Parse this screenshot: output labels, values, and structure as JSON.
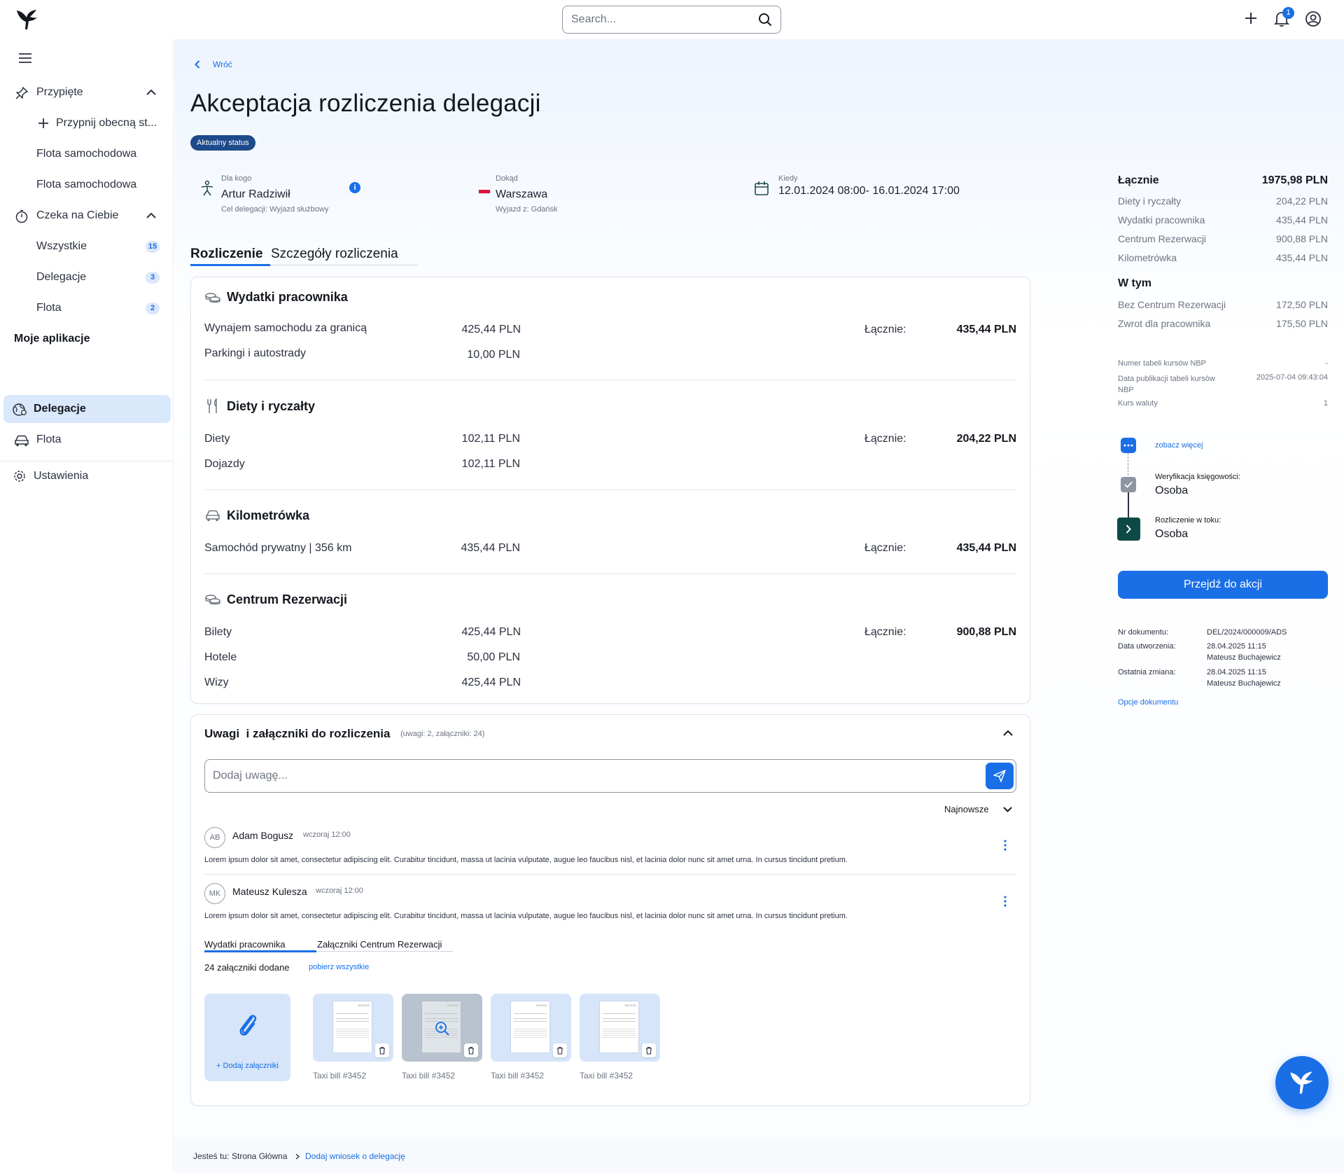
{
  "header": {
    "search_placeholder": "Search...",
    "notification_count": "1"
  },
  "sidebar": {
    "pinned_label": "Przypięte",
    "pin_current_label": "Przypnij obecną st...",
    "pinned_items": [
      "Flota samochodowa",
      "Flota samochodowa"
    ],
    "waiting_label": "Czeka na Ciebie",
    "waiting_items": [
      {
        "label": "Wszystkie",
        "badge": "15"
      },
      {
        "label": "Delegacje",
        "badge": "3"
      },
      {
        "label": "Flota",
        "badge": "2"
      }
    ],
    "apps_heading": "Moje aplikacje",
    "apps": [
      {
        "label": "Delegacje"
      },
      {
        "label": "Flota"
      }
    ],
    "settings_label": "Ustawienia"
  },
  "page": {
    "back_label": "Wróć",
    "title": "Akceptacja rozliczenia delegacji",
    "status_badge": "Aktualny status",
    "for_whom_label": "Dla kogo",
    "for_whom_value": "Artur Radziwił",
    "purpose": "Cel delegacji: Wyjazd służbowy",
    "where_label": "Dokąd",
    "where_value": "Warszawa",
    "departure": "Wyjazd z: Gdańsk",
    "when_label": "Kiedy",
    "when_value": "12.01.2024 08:00- 16.01.2024 17:00",
    "tabs": [
      "Rozliczenie",
      "Szczegóły rozliczenia"
    ]
  },
  "settlement": {
    "total_label": "Łącznie:",
    "sections": [
      {
        "title": "Wydatki pracownika",
        "icon": "coins-icon",
        "total": "435,44 PLN",
        "rows": [
          {
            "label": "Wynajem samochodu za granicą",
            "value": "425,44 PLN"
          },
          {
            "label": "Parkingi i autostrady",
            "value": "10,00 PLN"
          }
        ]
      },
      {
        "title": "Diety i ryczałty",
        "icon": "fork-knife-icon",
        "total": "204,22 PLN",
        "rows": [
          {
            "label": "Diety",
            "value": "102,11 PLN"
          },
          {
            "label": "Dojazdy",
            "value": "102,11 PLN"
          }
        ]
      },
      {
        "title": "Kilometrówka",
        "icon": "car-icon",
        "total": "435,44 PLN",
        "rows": [
          {
            "label": "Samochód prywatny | 356 km",
            "value": "435,44 PLN"
          }
        ]
      },
      {
        "title": "Centrum Rezerwacji",
        "icon": "coins-icon",
        "total": "900,88 PLN",
        "rows": [
          {
            "label": "Bilety",
            "value": "425,44 PLN"
          },
          {
            "label": "Hotele",
            "value": "50,00 PLN"
          },
          {
            "label": "Wizy",
            "value": "425,44 PLN"
          }
        ]
      }
    ]
  },
  "comments": {
    "title": "Uwagi  i załączniki do rozliczenia",
    "counts": "(uwagi: 2, załączniki: 24)",
    "input_placeholder": "Dodaj uwagę...",
    "sort_label": "Najnowsze",
    "items": [
      {
        "initials": "AB",
        "name": "Adam Bogusz",
        "time": "wczoraj 12:00",
        "text": "Lorem ipsum dolor sit amet, consectetur adipiscing elit. Curabitur tincidunt, massa ut lacinia vulputate, augue leo faucibus nisl, et lacinia dolor nunc sit amet urna. In cursus tincidunt pretium."
      },
      {
        "initials": "MK",
        "name": "Mateusz Kulesza",
        "time": "wczoraj 12:00",
        "text": "Lorem ipsum dolor sit amet, consectetur adipiscing elit. Curabitur tincidunt, massa ut lacinia vulputate, augue leo faucibus nisl, et lacinia dolor nunc sit amet urna. In cursus tincidunt pretium."
      }
    ],
    "attach_tabs": [
      "Wydatki pracownika",
      "Załączniki Centrum Rezerwacji"
    ],
    "attach_count": "24 załączniki dodane",
    "download_all": "pobierz wszystkie",
    "add_attachment": "+ Dodaj załączniki",
    "attachments": [
      "Taxi bill #3452",
      "Taxi bill #3452",
      "Taxi bill #3452",
      "Taxi bill #3452"
    ],
    "thumb_header": "INVOICE"
  },
  "summary": {
    "total_label": "Łącznie",
    "total_value": "1975,98 PLN",
    "rows": [
      {
        "label": "Diety i ryczałty",
        "value": "204,22 PLN"
      },
      {
        "label": "Wydatki pracownika",
        "value": "435,44 PLN"
      },
      {
        "label": "Centrum Rezerwacji",
        "value": "900,88 PLN"
      },
      {
        "label": "Kilometrówka",
        "value": "435,44 PLN"
      }
    ],
    "including_label": "W tym",
    "including_rows": [
      {
        "label": "Bez Centrum Rezerwacji",
        "value": "172,50 PLN"
      },
      {
        "label": "Zwrot dla pracownika",
        "value": "175,50 PLN"
      }
    ],
    "nbp": [
      {
        "label": "Numer tabeli kursów NBP",
        "value": "-"
      },
      {
        "label": "Data publikacji tabeli kursów NBP",
        "value": "2025-07-04 09:43:04"
      },
      {
        "label": "Kurs waluty",
        "value": "1"
      }
    ],
    "timeline": {
      "see_more": "zobacz więcej",
      "step1_label": "Weryfikacja księgowości:",
      "step1_value": "Osoba",
      "step2_label": "Rozliczenie w toku:",
      "step2_value": "Osoba"
    },
    "action_button": "Przejdź do akcji",
    "doc": {
      "number_label": "Nr dokumentu:",
      "number_value": "DEL/2024/000009/ADS",
      "created_label": "Data utworzenia:",
      "created_value": "28.04.2025 11:15",
      "created_by": "Mateusz Buchajewicz",
      "modified_label": "Ostatnia zmiana:",
      "modified_value": "28.04.2025 11:15",
      "modified_by": "Mateusz Buchajewicz",
      "options_label": "Opcje dokumentu"
    }
  },
  "footer": {
    "you_are_here": "Jesteś tu:",
    "crumbs": [
      "Strona Główna",
      "Dodaj wniosek o delegację"
    ]
  },
  "colors": {
    "accent": "#1a6fe6",
    "status_badge": "#1d4a8a",
    "timeline_dark": "#0e4a45"
  }
}
